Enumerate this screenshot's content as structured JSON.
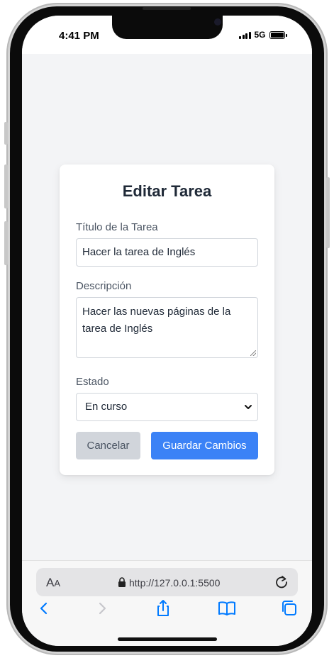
{
  "status_bar": {
    "time": "4:41 PM",
    "network": "5G",
    "signal_icon": "cellular-signal-icon",
    "battery_icon": "battery-icon",
    "battery_level": 1.0
  },
  "form": {
    "title": "Editar Tarea",
    "title_label": "Título de la Tarea",
    "title_value": "Hacer la tarea de Inglés",
    "description_label": "Descripción",
    "description_value": "Hacer las nuevas páginas de la tarea de Inglés",
    "status_label": "Estado",
    "status_value": "En curso",
    "cancel_label": "Cancelar",
    "save_label": "Guardar Cambios"
  },
  "browser": {
    "text_size_label": "AA",
    "url": "http://127.0.0.1:5500",
    "icons": [
      "lock-icon",
      "reload-icon",
      "back-icon",
      "forward-icon",
      "share-icon",
      "bookmarks-icon",
      "tabs-icon"
    ]
  },
  "colors": {
    "primary": "#3b82f6",
    "secondary": "#d1d5db",
    "page_background": "#f3f4f6",
    "ios_blue": "#007aff"
  }
}
